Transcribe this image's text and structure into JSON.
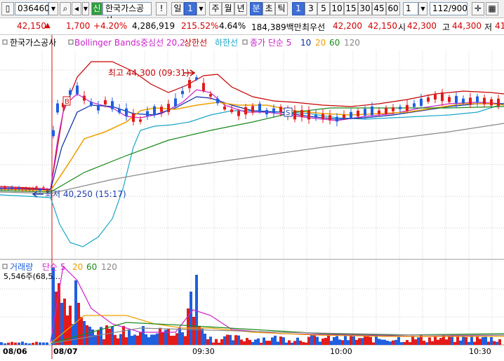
{
  "toolbar": {
    "code": "036460",
    "name": "한국가스공사",
    "period_day": "일",
    "period_num": "1",
    "periods": [
      "주",
      "월",
      "년",
      "분",
      "초",
      "틱"
    ],
    "intervals": [
      "1",
      "3",
      "5",
      "10",
      "15",
      "30",
      "45",
      "60"
    ],
    "interval_extra": "1",
    "count": "112/900"
  },
  "info": {
    "price": "42,150",
    "change": "1,700",
    "change_pct": "+4.20%",
    "volume": "4,286,919",
    "volume_ratio": "215.52%",
    "turnover_pct": "4.64%",
    "amount": "184,389백만",
    "best_ask_label": "최우선",
    "best_ask": "42,200",
    "best_bid": "42,150",
    "open_label": "시",
    "open": "42,300",
    "high_label": "고",
    "high": "44,300",
    "low_label": "저",
    "low_partial": "41"
  },
  "legend_price": {
    "name": "한국가스공사",
    "bollinger": "Bollinger Bands중심선 20,2",
    "upper": "상한선",
    "lower": "하한선",
    "ma_label": "종가 단순 5",
    "ma10": "10",
    "ma20": "20",
    "ma60": "60",
    "ma120": "120"
  },
  "legend_volume": {
    "label": "거래량",
    "ma_label": "단순 5",
    "ma20": "20",
    "ma60": "60",
    "ma120": "120",
    "max_label": "5,546주(68,5..."
  },
  "annotations": {
    "high": "최고 44,300 (09:31)",
    "low": "최저 40,250 (15:17)",
    "b_marker": "B",
    "s_marker": "S"
  },
  "colors": {
    "up": "#e31b1b",
    "down": "#1f5fe0",
    "boll_upper": "#c80000",
    "boll_lower": "#1aa7c8",
    "ma5": "#cc22cc",
    "ma10": "#0a2ca8",
    "ma20": "#f0a000",
    "ma60": "#1a8a1a",
    "ma120": "#888888",
    "grid": "#cfcfcf"
  },
  "chart_data": {
    "type": "candlestick",
    "x_ticks": [
      "08/06",
      "08/07",
      "09:30",
      "10:00",
      "10:30"
    ],
    "price_series": [
      {
        "name": "종가 단순 5"
      },
      {
        "name": "10"
      },
      {
        "name": "20"
      },
      {
        "name": "60"
      },
      {
        "name": "120"
      }
    ],
    "volume_series": [
      {
        "name": "단순 5"
      },
      {
        "name": "20"
      },
      {
        "name": "60"
      },
      {
        "name": "120"
      }
    ],
    "high": 44300,
    "high_time": "09:31",
    "low": 40250,
    "low_time": "15:17",
    "volume_max": 5546,
    "grid": true
  }
}
